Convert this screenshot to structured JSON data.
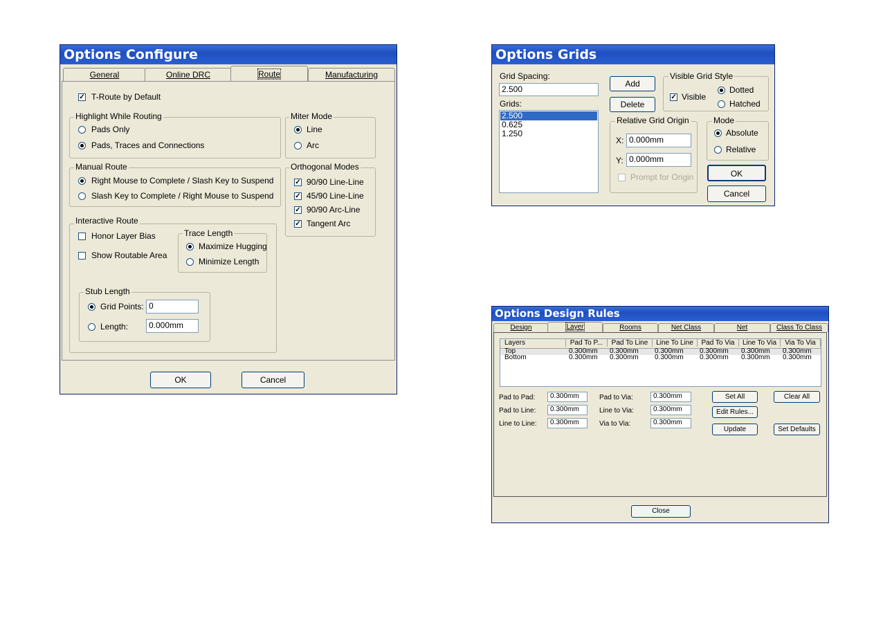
{
  "configure": {
    "title": "Options Configure",
    "tabs": [
      "General",
      "Online DRC",
      "Route",
      "Manufacturing"
    ],
    "t_route": "T-Route by Default",
    "highlight": {
      "label": "Highlight While Routing",
      "opt1": "Pads Only",
      "opt2": "Pads, Traces and Connections"
    },
    "miter": {
      "label": "Miter Mode",
      "opt1": "Line",
      "opt2": "Arc"
    },
    "manual": {
      "label": "Manual Route",
      "opt1": "Right Mouse to Complete / Slash Key to Suspend",
      "opt2": "Slash Key to Complete / Right Mouse to Suspend"
    },
    "ortho": {
      "label": "Orthogonal Modes",
      "opt1": "90/90  Line-Line",
      "opt2": "45/90  Line-Line",
      "opt3": "90/90  Arc-Line",
      "opt4": "Tangent Arc"
    },
    "interactive": {
      "label": "Interactive Route",
      "honor": "Honor Layer Bias",
      "show": "Show Routable Area"
    },
    "trace": {
      "label": "Trace Length",
      "opt1": "Maximize Hugging",
      "opt2": "Minimize Length"
    },
    "stub": {
      "label": "Stub Length",
      "grid_label": "Grid Points:",
      "grid_value": "0",
      "len_label": "Length:",
      "len_value": "0.000mm"
    },
    "ok": "OK",
    "cancel": "Cancel"
  },
  "grids": {
    "title": "Options Grids",
    "spacing_label": "Grid Spacing:",
    "spacing_value": "2.500",
    "grids_label": "Grids:",
    "grids_items": [
      "2.500",
      "0.625",
      "1.250"
    ],
    "add": "Add",
    "delete": "Delete",
    "visible_style": {
      "label": "Visible Grid Style",
      "visible": "Visible",
      "dotted": "Dotted",
      "hatched": "Hatched"
    },
    "origin": {
      "label": "Relative Grid Origin",
      "x_label": "X:",
      "x_value": "0.000mm",
      "y_label": "Y:",
      "y_value": "0.000mm",
      "prompt": "Prompt for Origin"
    },
    "mode": {
      "label": "Mode",
      "absolute": "Absolute",
      "relative": "Relative"
    },
    "ok": "OK",
    "cancel": "Cancel"
  },
  "rules": {
    "title": "Options Design Rules",
    "tabs": [
      "Design",
      "Layer",
      "Rooms",
      "Net Class",
      "Net",
      "Class To Class"
    ],
    "columns": [
      "Layers",
      "Pad To P...",
      "Pad To Line",
      "Line To Line",
      "Pad To Via",
      "Line To Via",
      "Via To Via"
    ],
    "rows": [
      [
        "Top",
        "0.300mm",
        "0.300mm",
        "0.300mm",
        "0.300mm",
        "0.300mm",
        "0.300mm"
      ],
      [
        "Bottom",
        "0.300mm",
        "0.300mm",
        "0.300mm",
        "0.300mm",
        "0.300mm",
        "0.300mm"
      ]
    ],
    "fields": {
      "pad_pad_label": "Pad to Pad:",
      "pad_pad": "0.300mm",
      "pad_line_label": "Pad to Line:",
      "pad_line": "0.300mm",
      "line_line_label": "Line to Line:",
      "line_line": "0.300mm",
      "pad_via_label": "Pad to Via:",
      "pad_via": "0.300mm",
      "line_via_label": "Line to Via:",
      "line_via": "0.300mm",
      "via_via_label": "Via to Via:",
      "via_via": "0.300mm"
    },
    "set_all": "Set All",
    "clear_all": "Clear All",
    "edit_rules": "Edit Rules...",
    "update": "Update",
    "set_defaults": "Set Defaults",
    "close": "Close"
  }
}
